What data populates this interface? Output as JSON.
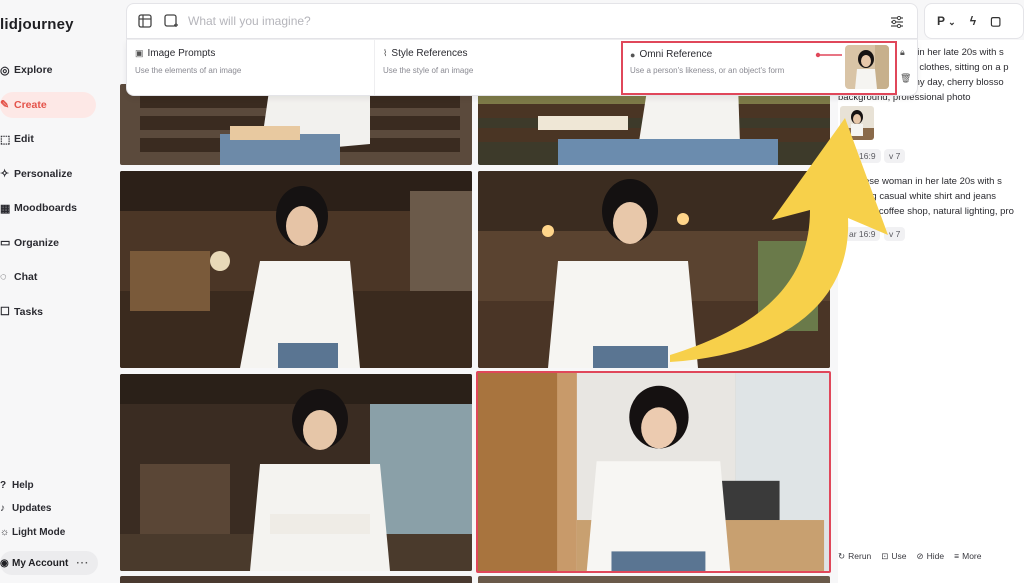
{
  "brand": {
    "name": "lidjourney"
  },
  "nav": {
    "items": [
      {
        "label": "Explore",
        "icon": "compass-icon"
      },
      {
        "label": "Create",
        "icon": "brush-icon",
        "active": true
      },
      {
        "label": "Edit",
        "icon": "edit-icon"
      },
      {
        "label": "Personalize",
        "icon": "sparkle-icon"
      },
      {
        "label": "Moodboards",
        "icon": "moodboard-icon"
      },
      {
        "label": "Organize",
        "icon": "folder-icon"
      },
      {
        "label": "Chat",
        "icon": "chat-icon"
      },
      {
        "label": "Tasks",
        "icon": "tasks-icon"
      }
    ]
  },
  "bottom_nav": {
    "help": "Help",
    "updates": "Updates",
    "light_mode": "Light Mode",
    "account": "My Account",
    "account_menu": "···"
  },
  "prompt": {
    "placeholder": "What will you imagine?"
  },
  "references": {
    "image_prompts": {
      "title": "Image Prompts",
      "subtitle": "Use the elements of an image"
    },
    "style_references": {
      "title": "Style References",
      "subtitle": "Use the style of an image"
    },
    "omni_reference": {
      "title": "Omni Reference",
      "subtitle": "Use a person's likeness, or an object's form"
    }
  },
  "topright": {
    "p_label": "P",
    "chevron": "⌄"
  },
  "right_panel": {
    "job1_lines": [
      "an in her late 20s with s",
      "ual clothes, sitting on a p",
      "unny day, cherry blosso",
      "background, professional photo"
    ],
    "job1_chips": [
      "16:9",
      "v 7"
    ],
    "job2_lines": [
      "ese woman in her late 20s with s",
      "ing casual white shirt and jeans",
      "modern coffee shop, natural lighting, pro"
    ],
    "job2_chips": [
      "ar 16:9",
      "v 7"
    ],
    "actions": [
      "Rerun",
      "Use",
      "Hide",
      "More"
    ]
  },
  "colors": {
    "accent": "#e4534a",
    "highlight_box": "#e0475a",
    "arrow_yellow": "#f7d04a"
  }
}
